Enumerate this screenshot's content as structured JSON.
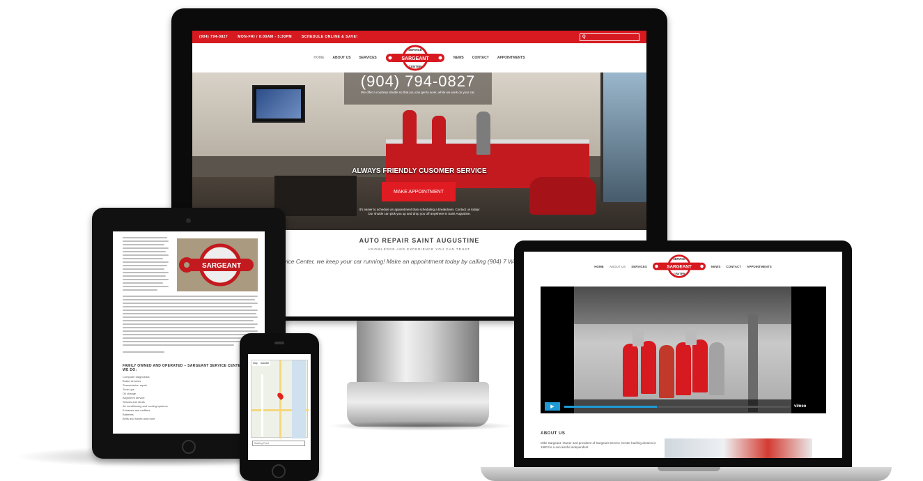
{
  "desktop": {
    "topbar": {
      "phone": "(904) 794-0827",
      "hours": "MON-FRI / 8:00AM - 5:30PM",
      "schedule": "SCHEDULE ONLINE & SAVE!",
      "search_glyph": "Q"
    },
    "nav": {
      "home": "HOME",
      "about": "ABOUT US",
      "services": "SERVICES",
      "news": "NEWS",
      "contact": "CONTACT",
      "appointments": "APPOINTMENTS"
    },
    "logo": {
      "top": "SERVICE",
      "middle": "SARGEANT",
      "bottom": "CENTER"
    },
    "hero": {
      "phone": "(904) 794-0827",
      "shuttle": "We offer a courtesy shuttle so that you can get to work, while we work on your car.",
      "tagline": "ALWAYS FRIENDLY CUSOMER SERVICE",
      "button": "MAKE APPOINTMENT",
      "fine": "It's easier to schedule an appointment than scheduling a breakdown. Contact us today! Our shuttle can pick you up and drop you off anywhere in Saint Augustine."
    },
    "section": {
      "title": "AUTO REPAIR SAINT AUGUSTINE",
      "kicker": "KNOWLEDGE AND EXPERIENCE YOU CAN TRUST",
      "blurb": "nt Service Center, we keep your car running! Make an appointment today by calling (904) 7 Walk-ins are welcomed."
    }
  },
  "tablet": {
    "heading": "FAMILY OWNED AND OPERATED – SARGEANT SERVICE CENTER & WHAT WE DO:",
    "list": [
      "Computer diagnostics",
      "Brake services",
      "Transmission repair",
      "Tune-ups",
      "Oil change",
      "Alignment service",
      "Shocks and struts",
      "Air conditioning and cooling systems",
      "Exhausts and mufflers",
      "Batteries",
      "Belts and hoses and more"
    ]
  },
  "phone": {
    "map_tab_1": "Map",
    "map_tab_2": "Satellite",
    "field_placeholder": "Starting Point"
  },
  "laptop": {
    "nav": {
      "home": "HOME",
      "about": "ABOUT US",
      "services": "SERVICES",
      "news": "NEWS",
      "contact": "CONTACT",
      "appointments": "APPOINTMENTS"
    },
    "video": {
      "play_glyph": "▶",
      "brand": "vimeo",
      "progress": 0.41
    },
    "about_title": "ABOUT US",
    "about_text": "Mike Sargeant, Owner and president of Sargeant Service Center had big dreams in 1980 for a successful independent"
  },
  "colors": {
    "brand_red": "#d71920",
    "video_blue": "#1e9bd7"
  }
}
